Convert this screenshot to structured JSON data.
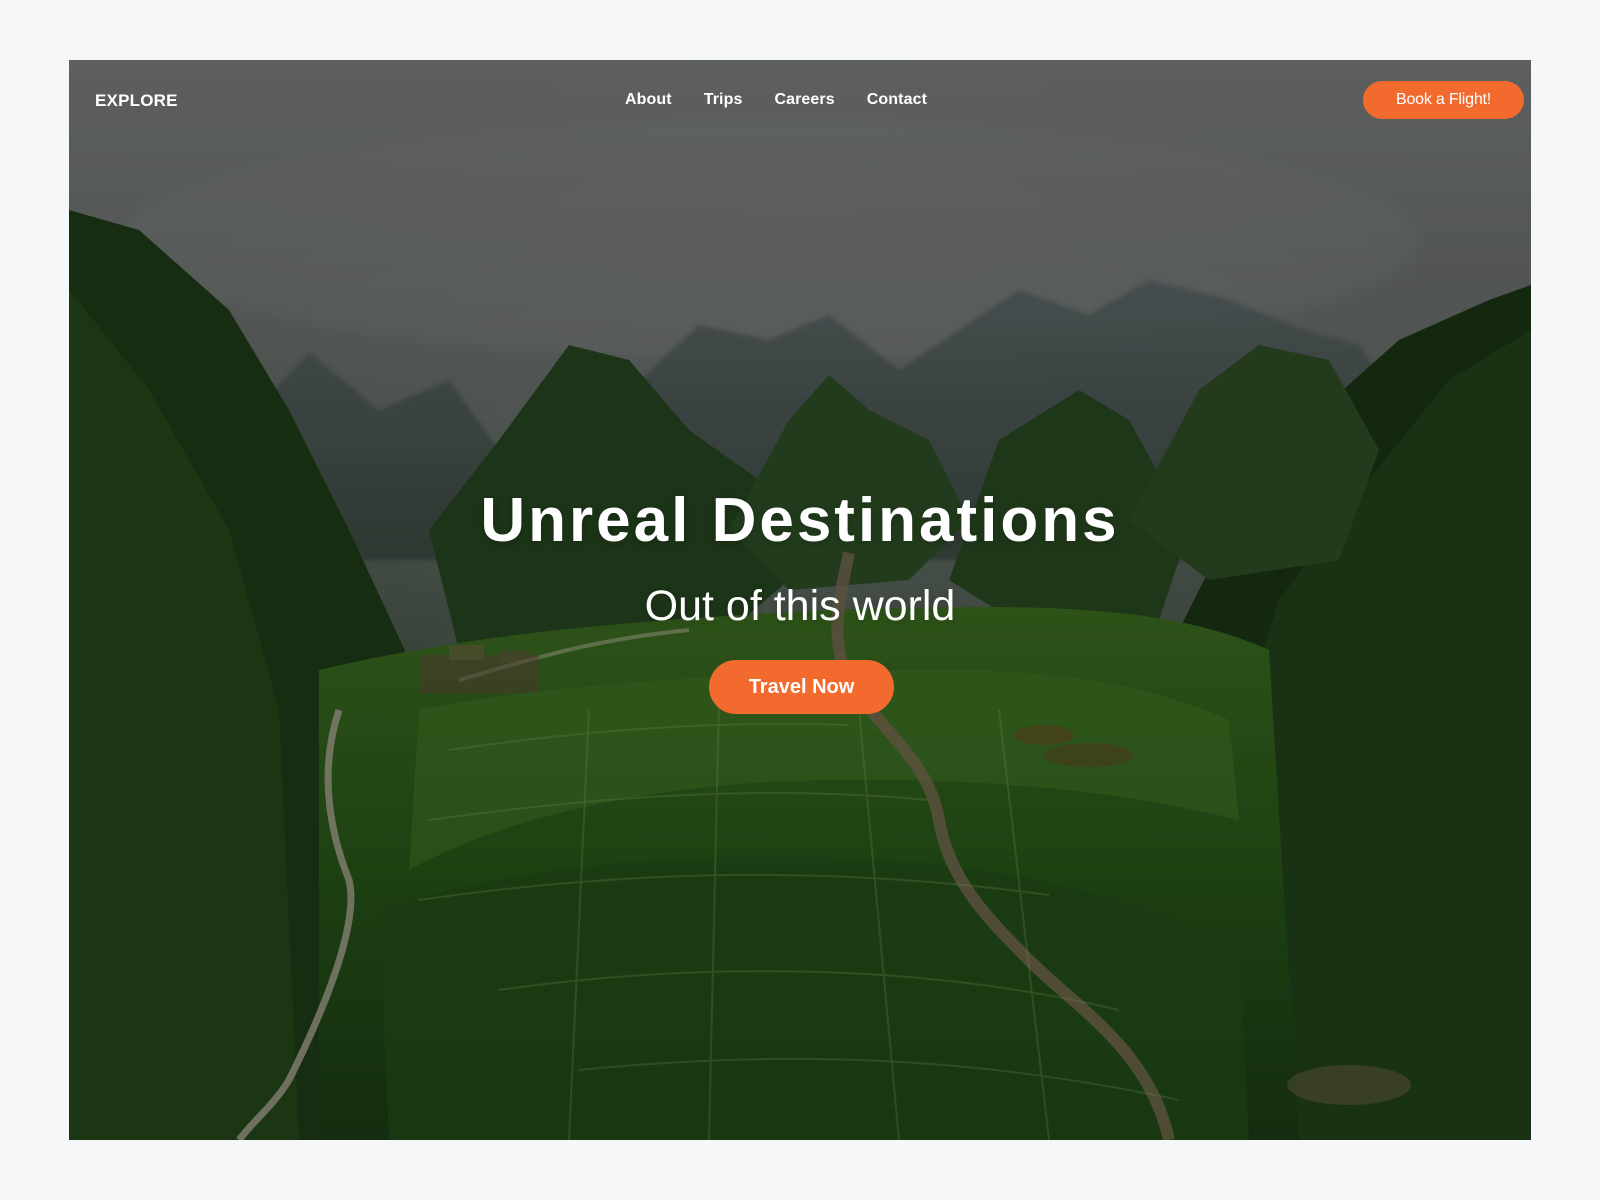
{
  "brand": {
    "logo_text": "EXPLORE"
  },
  "navigation": {
    "links": [
      {
        "label": "About"
      },
      {
        "label": "Trips"
      },
      {
        "label": "Careers"
      },
      {
        "label": "Contact"
      }
    ],
    "cta_label": "Book a Flight!"
  },
  "hero": {
    "title": "Unreal Destinations",
    "subtitle": "Out of this world",
    "button_label": "Travel Now",
    "image_subject": "aerial valley with green rice fields, winding river, and forested karst mountains"
  },
  "colors": {
    "accent": "#f26a2e",
    "page_background": "#f6f7f9",
    "foreground_text": "#ffffff"
  }
}
